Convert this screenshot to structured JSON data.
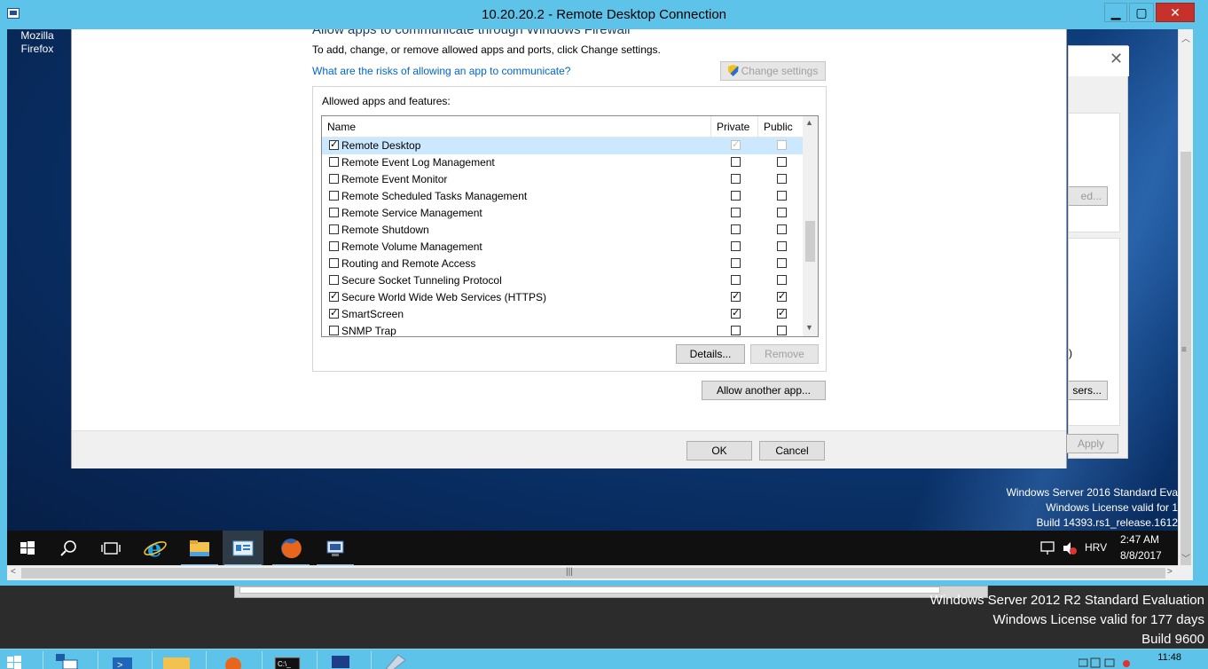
{
  "rdp_window": {
    "title": "10.20.20.2 - Remote Desktop Connection",
    "minimize": "▁",
    "maximize": "▢",
    "close": "✕"
  },
  "remote_desktop": {
    "icon_label": "Mozilla Firefox",
    "watermark": [
      "Windows Server 2016 Standard Eva",
      "Windows License valid for 1",
      "Build 14393.rs1_release.1612"
    ]
  },
  "firewall_dialog": {
    "heading": "Allow apps to communicate through Windows Firewall",
    "subtitle": "To add, change, or remove allowed apps and ports, click Change settings.",
    "risk_link": "What are the risks of allowing an app to communicate?",
    "change_settings": "Change settings",
    "group_label": "Allowed apps and features:",
    "columns": {
      "name": "Name",
      "private": "Private",
      "public": "Public"
    },
    "rows": [
      {
        "name": "Remote Desktop",
        "enabled": true,
        "private": true,
        "public": false,
        "selected": true,
        "dim": true
      },
      {
        "name": "Remote Event Log Management",
        "enabled": false,
        "private": false,
        "public": false
      },
      {
        "name": "Remote Event Monitor",
        "enabled": false,
        "private": false,
        "public": false
      },
      {
        "name": "Remote Scheduled Tasks Management",
        "enabled": false,
        "private": false,
        "public": false
      },
      {
        "name": "Remote Service Management",
        "enabled": false,
        "private": false,
        "public": false
      },
      {
        "name": "Remote Shutdown",
        "enabled": false,
        "private": false,
        "public": false
      },
      {
        "name": "Remote Volume Management",
        "enabled": false,
        "private": false,
        "public": false
      },
      {
        "name": "Routing and Remote Access",
        "enabled": false,
        "private": false,
        "public": false
      },
      {
        "name": "Secure Socket Tunneling Protocol",
        "enabled": false,
        "private": false,
        "public": false
      },
      {
        "name": "Secure World Wide Web Services (HTTPS)",
        "enabled": true,
        "private": true,
        "public": true
      },
      {
        "name": "SmartScreen",
        "enabled": true,
        "private": true,
        "public": true
      },
      {
        "name": "SNMP Trap",
        "enabled": false,
        "private": false,
        "public": false
      }
    ],
    "details_button": "Details...",
    "remove_button": "Remove",
    "allow_another": "Allow another app...",
    "ok_button": "OK",
    "cancel_button": "Cancel"
  },
  "background_window": {
    "close": "✕",
    "button_1": "ed...",
    "paren": ")",
    "button_2": "sers...",
    "apply": "Apply"
  },
  "remote_taskbar": {
    "icons": [
      "windows-start-icon",
      "search-icon",
      "task-view-icon",
      "internet-explorer-icon",
      "file-explorer-icon",
      "server-manager-icon",
      "firefox-icon",
      "remote-connection-icon"
    ],
    "language": "HRV",
    "time": "2:47 AM",
    "date": "8/8/2017"
  },
  "host": {
    "watermark": [
      "Windows Server 2012 R2 Standard Evaluation",
      "Windows License valid for 177 days",
      "Build 9600"
    ],
    "clock": "11:48"
  }
}
